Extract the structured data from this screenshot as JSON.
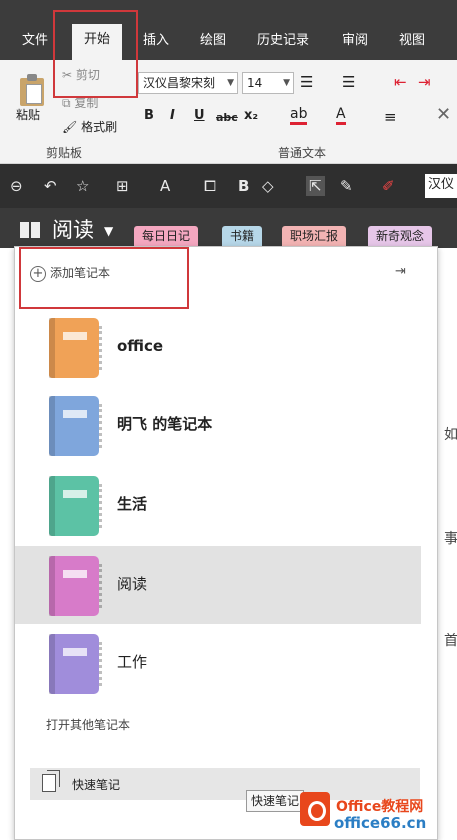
{
  "ribbon_tabs": [
    "文件",
    "开始",
    "插入",
    "绘图",
    "历史记录",
    "审阅",
    "视图"
  ],
  "active_tab": "开始",
  "clipboard": {
    "paste": "粘贴",
    "cut": "剪切",
    "copy": "复制",
    "format_painter": "格式刷",
    "group_label": "剪贴板"
  },
  "font": {
    "family": "汉仪昌黎宋刻",
    "size": "14",
    "group_label": "普通文本"
  },
  "format_buttons": [
    "B",
    "I",
    "U",
    "abc",
    "x₂"
  ],
  "quick_toolbar": {
    "font_field": "汉仪"
  },
  "notebook_header": {
    "title": "阅读",
    "section_tabs": [
      "每日日记",
      "书籍",
      "职场汇报",
      "新奇观念"
    ]
  },
  "section_tab_colors": [
    "#f4a7c0",
    "#b6d7e8",
    "#f2b3b3",
    "#e6c6e8"
  ],
  "panel": {
    "add_notebook": "添加笔记本",
    "notebooks": [
      {
        "name": "office",
        "color": "#f0a257",
        "bold": true
      },
      {
        "name": "明飞 的笔记本",
        "color": "#7fa6dc",
        "bold": true
      },
      {
        "name": "生活",
        "color": "#5cc2a5",
        "bold": true
      },
      {
        "name": "阅读",
        "color": "#d77bc9",
        "bold": false
      },
      {
        "name": "工作",
        "color": "#a08ddb",
        "bold": false
      }
    ],
    "open_other": "打开其他笔记本",
    "quick_notes": "快速笔记",
    "tooltip": "快速笔记"
  },
  "doc_glimpse_chars": [
    "如",
    "事",
    "首"
  ],
  "watermark": {
    "line1": "Office教程网",
    "line2": "office66.cn"
  },
  "colors": {
    "highlight": "#d0383b",
    "ribbon_dark": "#3c3c3c",
    "selected_row": "#e2e2e2"
  }
}
